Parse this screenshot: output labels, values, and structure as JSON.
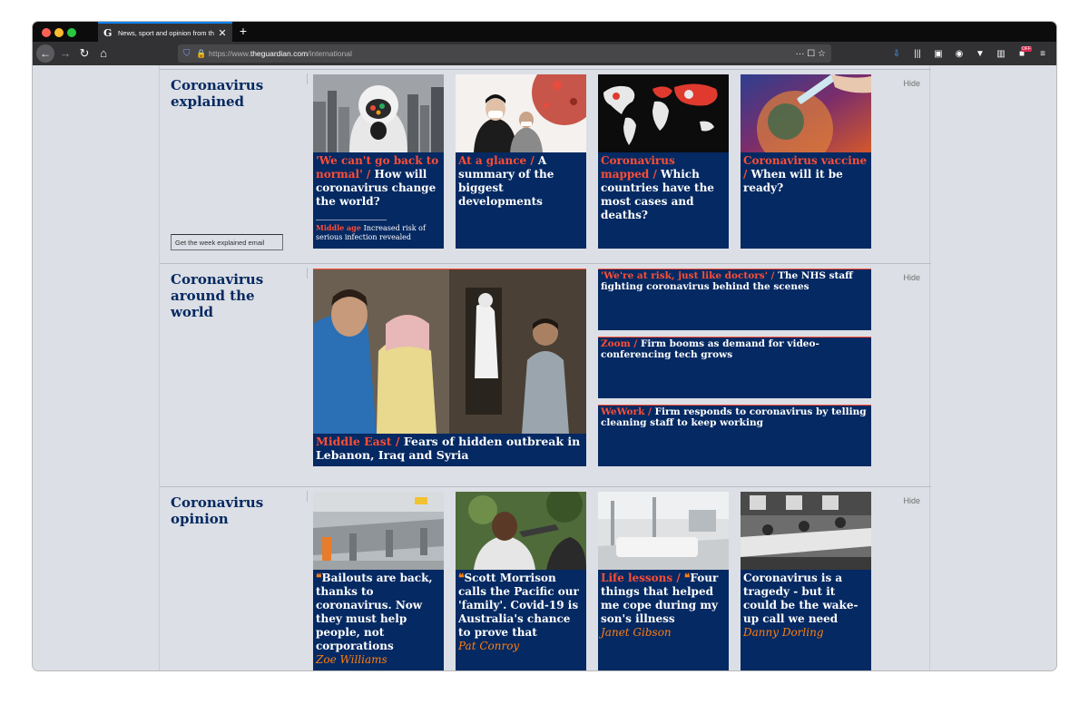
{
  "browser": {
    "tab_title": "News, sport and opinion from th",
    "tab_favicon": "G",
    "close_glyph": "✕",
    "new_tab_glyph": "+",
    "url_scheme": "https://www.",
    "url_host": "theguardian.com",
    "url_path": "/international",
    "page_actions": "··· ☐ ☆",
    "badge": "OFF"
  },
  "sections": [
    {
      "title": "Coronavirus explained",
      "hide": "Hide",
      "email_button": "Get the week explained email",
      "cards": [
        {
          "kicker": "'We can't go back to normal' / ",
          "headline": "How will coronavirus change the world?",
          "sub_kicker": "Middle age ",
          "sub_text": "Increased risk of serious infection revealed",
          "image": "hazmat-mask-photo"
        },
        {
          "kicker": "At a glance / ",
          "headline": "A summary of the biggest developments",
          "image": "masked-people-photo"
        },
        {
          "kicker": "Coronavirus mapped / ",
          "headline": "Which countries have the most cases and deaths?",
          "image": "world-map-graphic"
        },
        {
          "kicker": "Coronavirus vaccine / ",
          "headline": "When will it be ready?",
          "image": "vaccine-illustration"
        }
      ]
    },
    {
      "title": "Coronavirus around the world",
      "hide": "Hide",
      "main_card": {
        "kicker": "Middle East / ",
        "headline": "Fears of hidden outbreak in Lebanon, Iraq and Syria",
        "image": "children-sanitizing-photo"
      },
      "side_cards": [
        {
          "kicker": "'We're at risk, just like doctors' / ",
          "headline": "The NHS staff fighting coronavirus behind the scenes"
        },
        {
          "kicker": "Zoom / ",
          "headline": "Firm booms as demand for video-conferencing tech grows"
        },
        {
          "kicker": "WeWork / ",
          "headline": "Firm responds to coronavirus by telling cleaning staff to keep working"
        }
      ]
    },
    {
      "title": "Coronavirus opinion",
      "hide": "Hide",
      "cards": [
        {
          "kicker": "",
          "quote": true,
          "headline": "Bailouts are back, thanks to coronavirus. Now they must help people, not corporations",
          "byline": "Zoe Williams",
          "image": "airport-checkin-photo"
        },
        {
          "kicker": "",
          "quote": true,
          "headline": "Scott Morrison calls the Pacific our 'family'. Covid-19 is Australia's chance to prove that",
          "byline": "Pat Conroy",
          "image": "temperature-check-photo"
        },
        {
          "kicker": "Life lessons / ",
          "quote": true,
          "headline": "Four things that helped me cope during my son's illness",
          "byline": "Janet Gibson",
          "image": "hospital-ward-photo"
        },
        {
          "kicker": "",
          "quote": false,
          "headline": "Coronavirus is a tragedy - but it could be the wake-up call we need",
          "byline": "Danny Dorling",
          "image": "historic-ward-photo"
        }
      ]
    }
  ],
  "colors": {
    "navy": "#052962",
    "red": "#ff4e36",
    "orange": "#ff7f0f"
  }
}
